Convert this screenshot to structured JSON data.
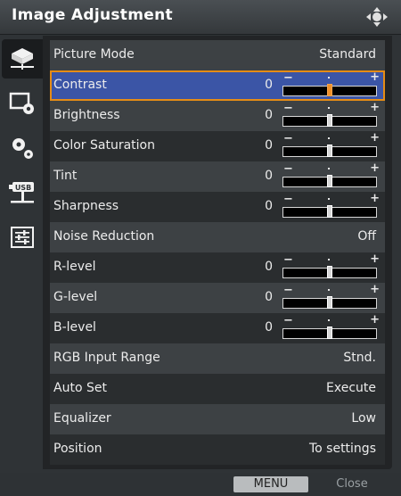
{
  "window": {
    "title": "Image Adjustment",
    "nav_icon": "four-way-nav-icon"
  },
  "side_tabs": [
    {
      "icon": "projector-image-icon",
      "active": true
    },
    {
      "icon": "screen-settings-icon",
      "active": false
    },
    {
      "icon": "gears-icon",
      "active": false
    },
    {
      "icon": "usb-icon",
      "active": false
    },
    {
      "icon": "sliders-icon",
      "active": false
    }
  ],
  "rows": [
    {
      "label": "Picture Mode",
      "value": "Standard"
    },
    {
      "label": "Contrast",
      "number": "0",
      "level": 0.5,
      "selected": true
    },
    {
      "label": "Brightness",
      "number": "0",
      "level": 0.5
    },
    {
      "label": "Color Saturation",
      "number": "0",
      "level": 0.5
    },
    {
      "label": "Tint",
      "number": "0",
      "level": 0.5
    },
    {
      "label": "Sharpness",
      "number": "0",
      "level": 0.5
    },
    {
      "label": "Noise Reduction",
      "value": "Off"
    },
    {
      "label": "R-level",
      "number": "0",
      "level": 0.5
    },
    {
      "label": "G-level",
      "number": "0",
      "level": 0.5
    },
    {
      "label": "B-level",
      "number": "0",
      "level": 0.5
    },
    {
      "label": "RGB Input Range",
      "value": "Stnd."
    },
    {
      "label": "Auto Set",
      "value": "Execute"
    },
    {
      "label": "Equalizer",
      "value": "Low"
    },
    {
      "label": "Position",
      "value": "To settings"
    }
  ],
  "slider_marks": {
    "minus": "−",
    "plus": "+"
  },
  "footer": {
    "menu_label": "MENU",
    "close_label": "Close"
  },
  "colors": {
    "selection": "#3b55a6",
    "highlight": "#e58c16"
  }
}
